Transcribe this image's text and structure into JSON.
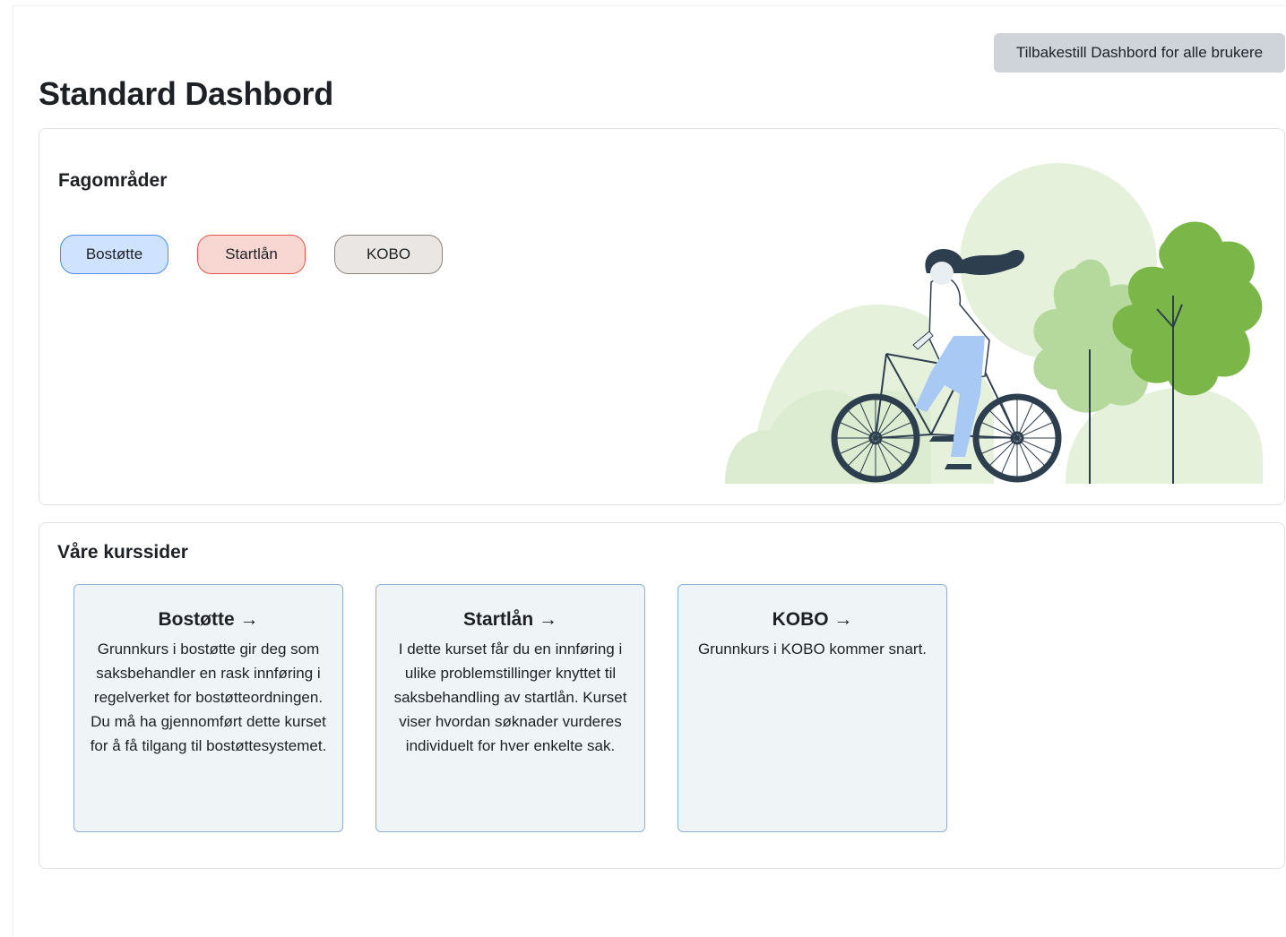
{
  "header": {
    "reset_button_label": "Tilbakestill Dashbord for alle brukere",
    "page_title": "Standard Dashbord"
  },
  "areas": {
    "title": "Fagområder",
    "pills": [
      {
        "label": "Bostøtte",
        "color": "#cfe2ff",
        "border": "#4d8bf0"
      },
      {
        "label": "Startlån",
        "color": "#f8d7d3",
        "border": "#e0584a"
      },
      {
        "label": "KOBO",
        "color": "#e9e6e3",
        "border": "#8a8480"
      }
    ]
  },
  "courses": {
    "title": "Våre kurssider",
    "items": [
      {
        "title": "Bostøtte →",
        "description": "Grunnkurs i bostøtte gir deg som saksbehandler en rask innføring i regelverket for bostøtteordningen. Du må ha gjennomført dette kurset for å få tilgang til bostøttesystemet."
      },
      {
        "title": "Startlån →",
        "description": "I dette kurset får du en innføring i ulike problemstillinger knyttet til saksbehandling av startlån. Kurset viser hvordan søknader vurderes individuelt for hver enkelte sak."
      },
      {
        "title": "KOBO →",
        "description": "Grunnkurs i KOBO kommer snart."
      }
    ]
  },
  "colors": {
    "accent_card": "#eff4f7",
    "card_border": "#8db2d6",
    "tree_green": "#7ab648",
    "tree_light": "#b5d99c",
    "bg_blob": "#e6f1dc",
    "bike_dark": "#2d3e4e",
    "pants_blue": "#a9c9f5"
  }
}
